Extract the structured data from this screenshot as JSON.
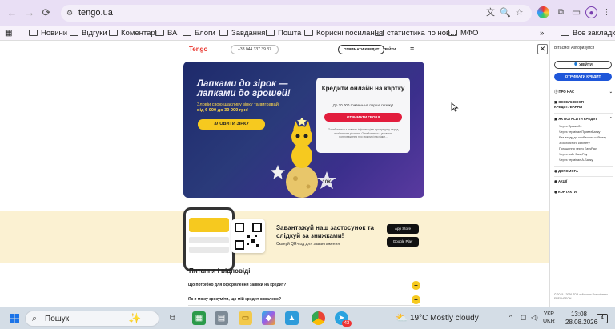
{
  "browser": {
    "url": "tengo.ua",
    "bookmarks": [
      "Новини",
      "Відгуки",
      "Коментарі",
      "ВА",
      "Блоги",
      "Завдання",
      "Пошта",
      "Корисні посилання",
      "статистика по нов...",
      "МФО"
    ],
    "all_bookmarks": "Все закладки",
    "overflow": "»"
  },
  "site": {
    "logo": "Tengo",
    "phone": "+38 044 337 39 37",
    "get_credit": "ОТРИМАТИ КРЕДИТ",
    "login": "УВІЙТИ",
    "hero": {
      "title": "Лапками до зірок — лапками до грошей!",
      "sub": "Зловіи свою щасливу зірку та вигравай",
      "amount": "від 6 000 до 30 000 грн!",
      "button": "ЗЛОВИТИ ЗІРКУ",
      "card_title": "Кредити онлайн на картку",
      "card_sub": "До 20 000 гривень на перше позику!",
      "card_button": "ОТРИМАТИ ГРОШІ",
      "card_note": "Ознайомтеся з повною інформацією про кредиту перед прийняттям рішення. Ознайомтеся з умовами попередження про можливі наслідки..."
    },
    "promo": {
      "title": "Завантажуй наш застосунок та слідкуй за знижками!",
      "sub": "Скануй QR-код для завантаження",
      "app_store": "App Store",
      "google_play": "Google Play"
    },
    "faq": {
      "title": "Питання і відповіді",
      "items": [
        "Що потрібно для оформлення заявки на кредит?",
        "Як я можу зрозуміти, що мій кредит схвалено?"
      ]
    }
  },
  "side_menu": {
    "greeting": "Вітаємо! Авторизуйся",
    "login": "УВІЙТИ",
    "get_credit": "ОТРИМАТИ КРЕДИТ",
    "sections": [
      "ПРО НАС",
      "ОСОБЛИВОСТІ КРЕДИТУВАННЯ",
      "ЯК ПОГАСИТИ КРЕДИТ"
    ],
    "sub_items": [
      "Через Приват24",
      "Через термінал ПриватБанку",
      "Без входу до особистого кабінету",
      "З особистого кабінету",
      "Погашення через EasyPay",
      "Через сайт EasyPay",
      "Через термінал А-Банку"
    ],
    "bottom_sections": [
      "ДОПОМОГА",
      "АКЦІЇ",
      "КОНТАКТИ"
    ],
    "footer": "© 2015 - 2026 ТОВ «Мілоан» Розроблено FRESHTECH"
  },
  "taskbar": {
    "search": "Пошук",
    "weather": "19°C",
    "weather_text": "Mostly cloudy",
    "lang": "УКР",
    "lang2": "UKR",
    "time": "13:08",
    "date": "28.08.2026",
    "notif": "4",
    "telegram_badge": "43"
  },
  "colors": {
    "tab_bar": "#e9dff5",
    "hero_bg": "#2a3a7a",
    "accent_yellow": "#f6c91f",
    "accent_red": "#e21d3d",
    "side_blue": "#1e56d9"
  }
}
